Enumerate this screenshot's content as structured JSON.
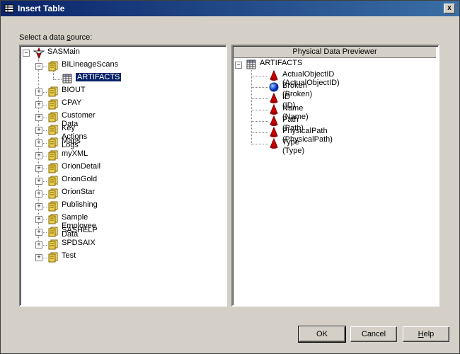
{
  "window": {
    "title": "Insert Table",
    "close_label": "x"
  },
  "source": {
    "label_pre": "Select a data ",
    "label_ul": "s",
    "label_post": "ource:"
  },
  "tree": {
    "root": "SASMain",
    "child": "BILineageScans",
    "leaf": "ARTIFACTS",
    "libraries": [
      "BIOUT",
      "CPAY",
      "Customer Data",
      "Key Actions Logs",
      "Maps",
      "myXML",
      "OrionDetail",
      "OrionGold",
      "OrionStar",
      "Publishing",
      "Sample Employee Data",
      "SASHELP",
      "SPDSAIX",
      "Test"
    ]
  },
  "preview": {
    "header": "Physical Data Previewer",
    "table": "ARTIFACTS",
    "columns": [
      {
        "label": "ActualObjectID (ActualObjectID)",
        "kind": "cone"
      },
      {
        "label": "Broken (Broken)",
        "kind": "sphere"
      },
      {
        "label": "ID (ID)",
        "kind": "cone"
      },
      {
        "label": "Name (Name)",
        "kind": "cone"
      },
      {
        "label": "Path (Path)",
        "kind": "cone"
      },
      {
        "label": "PhysicalPath (PhysicalPath)",
        "kind": "cone"
      },
      {
        "label": "Type (Type)",
        "kind": "cone"
      }
    ]
  },
  "buttons": {
    "ok": "OK",
    "cancel": "Cancel",
    "help": "Help"
  }
}
